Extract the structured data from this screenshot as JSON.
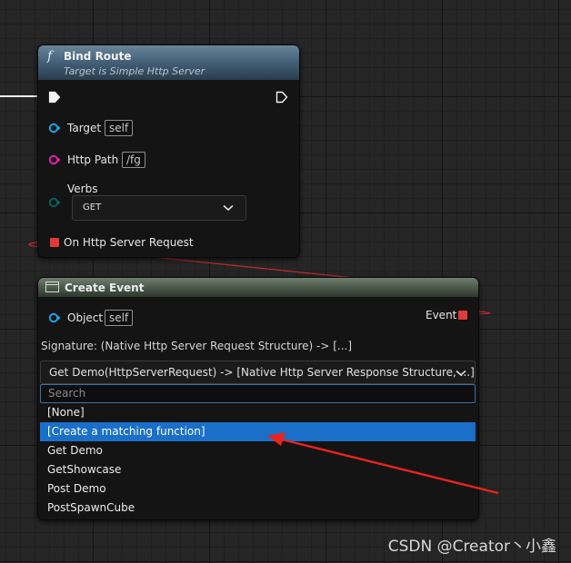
{
  "bind_route": {
    "title": "Bind Route",
    "subtitle": "Target is Simple Http Server",
    "pins": {
      "target_label": "Target",
      "target_value": "self",
      "http_path_label": "Http Path",
      "http_path_value": "/fg",
      "verbs_label": "Verbs",
      "verbs_value": "GET",
      "server_request_label": "On Http Server Request"
    }
  },
  "create_event": {
    "title": "Create Event",
    "object_label": "Object",
    "object_value": "self",
    "event_label": "Event",
    "signature": "Signature: (Native Http Server Request Structure) -> [...]",
    "selected_function": "Get Demo(HttpServerRequest) -> [Native Http Server Response Structure, ...]",
    "search_placeholder": "Search",
    "options": [
      {
        "label": "[None]",
        "selected": false
      },
      {
        "label": "[Create a matching function]",
        "selected": true
      },
      {
        "label": "Get Demo",
        "selected": false
      },
      {
        "label": "GetShowcase",
        "selected": false
      },
      {
        "label": "Post Demo",
        "selected": false
      },
      {
        "label": "PostSpawnCube",
        "selected": false
      }
    ]
  },
  "watermark": "CSDN @Creator丶小鑫",
  "colors": {
    "object_pin": "#1da5e6",
    "string_pin": "#e21fb2",
    "enum_pin": "#0b5e5a",
    "delegate_pin": "#e23a3a",
    "annotation_arrow": "#e8241d",
    "selection": "#1a6fc9"
  },
  "icons": [
    "function-icon",
    "exec-pin-icon",
    "object-pin-icon",
    "string-pin-icon",
    "enum-pin-icon",
    "delegate-pin-icon",
    "chevron-down-icon",
    "event-grid-icon"
  ]
}
